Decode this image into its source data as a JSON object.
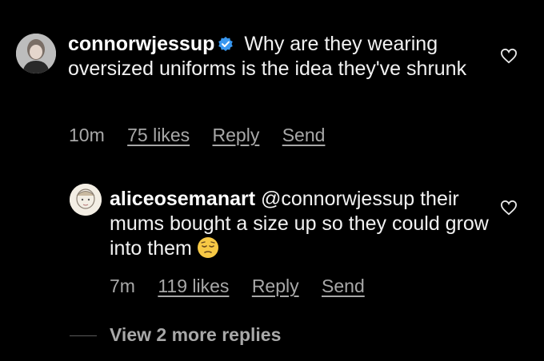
{
  "comments": [
    {
      "username": "connorwjessup",
      "verified": true,
      "text": "Why are they wearing oversized uniforms is the idea they've shrunk",
      "time": "10m",
      "likes": "75 likes",
      "reply": "Reply",
      "send": "Send"
    },
    {
      "username": "aliceosemanart",
      "mention": "@connorwjessup",
      "text": "their mums bought a size up so they could grow into them",
      "emoji": "pensive-face",
      "time": "7m",
      "likes": "119 likes",
      "reply": "Reply",
      "send": "Send"
    }
  ],
  "view_more": "View 2 more replies"
}
